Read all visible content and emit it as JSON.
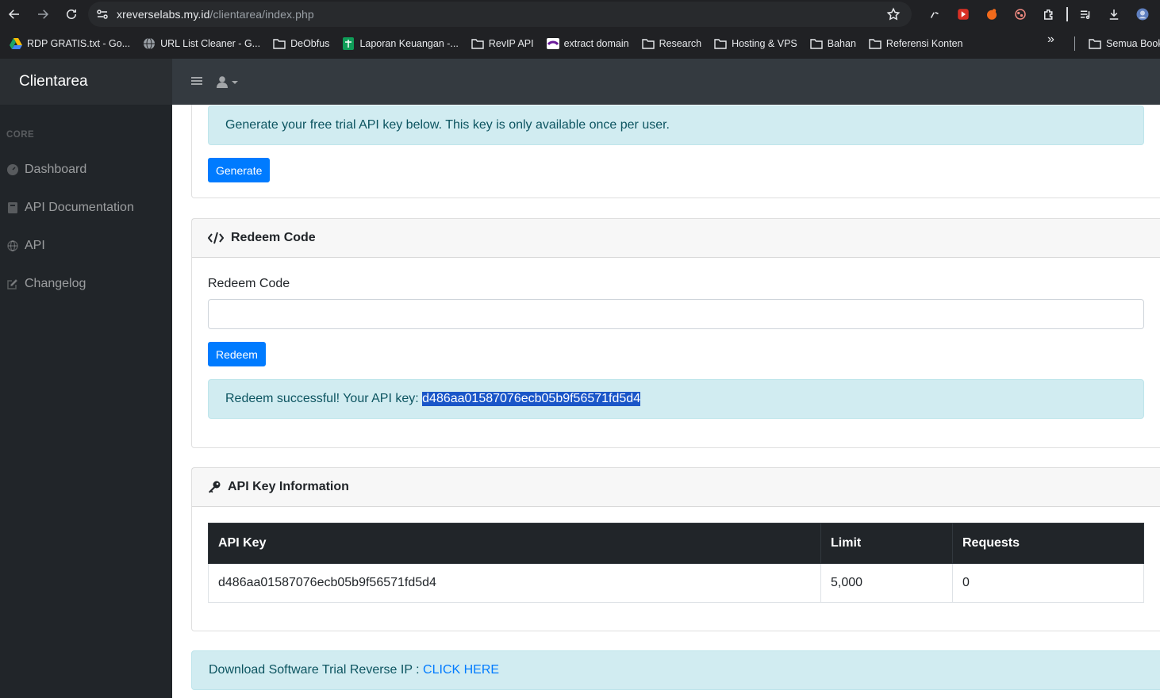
{
  "browser": {
    "url_host": "xreverselabs.my.id",
    "url_path": "/clientarea/index.php",
    "bookmarks": [
      {
        "label": "RDP GRATIS.txt - Go...",
        "icon": "google-drive-icon"
      },
      {
        "label": "URL List Cleaner - G...",
        "icon": "globe-icon"
      },
      {
        "label": "DeObfus",
        "icon": "folder-icon"
      },
      {
        "label": "Laporan Keuangan -...",
        "icon": "sheets-icon"
      },
      {
        "label": "RevIP API",
        "icon": "folder-icon"
      },
      {
        "label": "extract domain",
        "icon": "site-icon"
      },
      {
        "label": "Research",
        "icon": "folder-icon"
      },
      {
        "label": "Hosting & VPS",
        "icon": "folder-icon"
      },
      {
        "label": "Bahan",
        "icon": "folder-icon"
      },
      {
        "label": "Referensi Konten",
        "icon": "folder-icon"
      }
    ],
    "more_bookmarks": "»",
    "all_bookmarks_label": "Semua Book"
  },
  "navbar": {
    "brand": "Clientarea"
  },
  "sidebar": {
    "heading": "CORE",
    "items": [
      {
        "label": "Dashboard",
        "icon": "tachometer-icon"
      },
      {
        "label": "API Documentation",
        "icon": "book-icon"
      },
      {
        "label": "API",
        "icon": "globe-icon"
      },
      {
        "label": "Changelog",
        "icon": "edit-icon"
      }
    ]
  },
  "trial": {
    "alert": "Generate your free trial API key below. This key is only available once per user.",
    "button": "Generate"
  },
  "redeem": {
    "title": "Redeem Code",
    "label": "Redeem Code",
    "input_value": "",
    "button": "Redeem",
    "success_prefix": "Redeem successful! Your API key: ",
    "success_key": "d486aa01587076ecb05b9f56571fd5d4"
  },
  "api_info": {
    "title": "API Key Information",
    "columns": [
      "API Key",
      "Limit",
      "Requests"
    ],
    "rows": [
      [
        "d486aa01587076ecb05b9f56571fd5d4",
        "5,000",
        "0"
      ]
    ]
  },
  "download": {
    "text": "Download Software Trial Reverse IP : ",
    "link": "CLICK HERE"
  },
  "colors": {
    "primary": "#007bff",
    "alert_info_bg": "#d1ecf1",
    "dark": "#212529",
    "navbar": "#343a40"
  }
}
